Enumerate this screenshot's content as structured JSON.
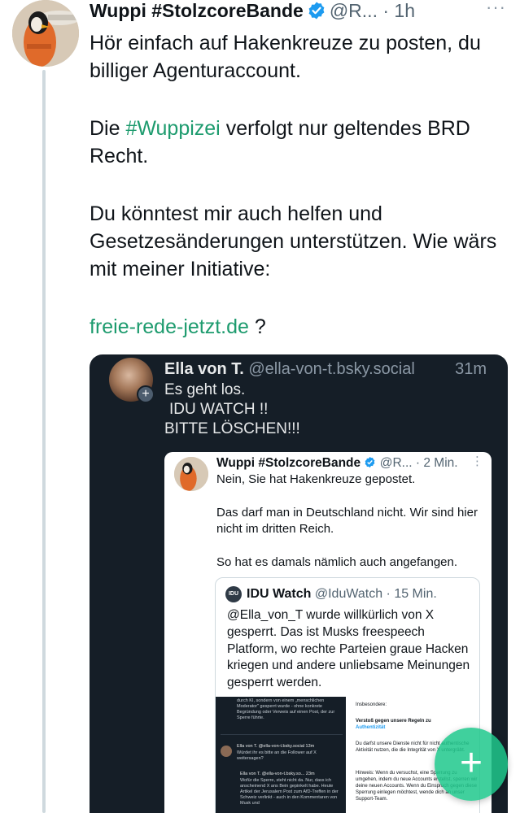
{
  "post": {
    "author_name": "Wuppi #StolzcoreBande",
    "handle_time": "@R... · 1h",
    "more": "···",
    "paragraph1": "Hör einfach auf Hakenkreuze zu posten, du billiger Agenturaccount.",
    "paragraph2_pre": "Die ",
    "paragraph2_hashtag": "#Wuppizei",
    "paragraph2_post": " verfolgt nur geltendes BRD Recht.",
    "paragraph3": "Du könntest mir auch helfen und Gesetzesänderungen unterstützen. Wie wärs mit meiner Initiative:",
    "link": "freie-rede-jetzt.de",
    "link_suffix": " ?"
  },
  "embed": {
    "author_name": "Ella von T.",
    "handle": "@ella-von-t.bsky.social",
    "time": "31m",
    "plus": "+",
    "line1": "Es geht los.",
    "line2": "IDU WATCH !!",
    "line3": "BITTE LÖSCHEN!!!"
  },
  "card": {
    "author_name": "Wuppi #StolzcoreBande",
    "handle_time": "@R... · 2 Min.",
    "more": "⋮",
    "p1": "Nein, Sie hat Hakenkreuze gepostet.",
    "p2": "Das darf man in Deutschland nicht. Wir sind hier nicht im dritten Reich.",
    "p3": "So hat es damals nämlich auch angefangen."
  },
  "inner": {
    "logo": "IDU",
    "author_name": "IDU Watch",
    "handle_time": "@IduWatch · 15 Min.",
    "text": "@Ella_von_T wurde willkürlich von X gesperrt. Das ist Musks freespeech Platform, wo rechte Parteien graue Hacken kriegen und andere unliebsame Meinungen gesperrt werden."
  },
  "mini_left": {
    "top_text": "durch KI, sondern von einem „menschlichen Moderator\" gesperrt wurde - ohne konkrete Begründung oder Verweis auf einen Post, der zur Sperre führte.",
    "post1_head": "Ella von T. @ella-von-t.bsky.social 13m",
    "post1_text": "Würdet ihr es bitte an die Follower auf X weitersagen?",
    "post2_head": "Ella von T. @ella-von-t.bsky.so... 23m",
    "post2_text": "Wofür die Sperre, steht nicht da. Nur, dass ich anscheinend X ans Bein gepinkelt habe. Heute Artikel der Jerusalem Post zum AfD-Treffen in der Schweiz verlinkt - auch in den Kommentaren von Musk und"
  },
  "mini_right": {
    "label": "Insbesondere:",
    "violation": "Verstoß gegen unsere Regeln zu",
    "violation_link": "Authentizität",
    "text1": "Du darfst unsere Dienste nicht für nicht authentische Aktivität nutzen, die die Integrität von X untergräbt.",
    "text2": "Hinweis: Wenn du versuchst, eine Sperrung zu umgehen, indem du neue Accounts erstellst, sperren wir deine neuen Accounts. Wenn du Einspruch gegen diese Sperrung einlegen möchtest, wende dich an unser Support-Team."
  },
  "fab": {
    "icon": "+"
  },
  "colors": {
    "link": "#1d9b6e",
    "verified": "#1d9bf0",
    "dark_bg": "#151e27",
    "fab": "#1fc88c"
  }
}
